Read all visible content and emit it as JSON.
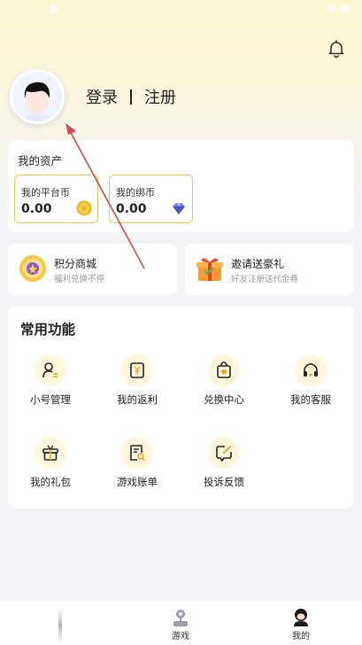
{
  "login": {
    "login_label": "登录",
    "register_label": "注册"
  },
  "assets": {
    "title": "我的资产",
    "platform_coin": {
      "label": "我的平台币",
      "value": "0.00"
    },
    "bound_coin": {
      "label": "我的绑币",
      "value": "0.00"
    }
  },
  "promos": [
    {
      "title": "积分商城",
      "subtitle": "福利兑换不停"
    },
    {
      "title": "邀请送豪礼",
      "subtitle": "好友注册送代金券"
    }
  ],
  "functions": {
    "title": "常用功能",
    "items": [
      {
        "label": "小号管理"
      },
      {
        "label": "我的返利"
      },
      {
        "label": "兑换中心"
      },
      {
        "label": "我的客服"
      },
      {
        "label": "我的礼包"
      },
      {
        "label": "游戏账单"
      },
      {
        "label": "投诉反馈"
      }
    ]
  },
  "tabs": [
    {
      "label": ""
    },
    {
      "label": "游戏"
    },
    {
      "label": "我的"
    }
  ],
  "colors": {
    "accent": "#f0a31e",
    "coin_border": "#f0c25c",
    "arrow": "#d94848"
  }
}
